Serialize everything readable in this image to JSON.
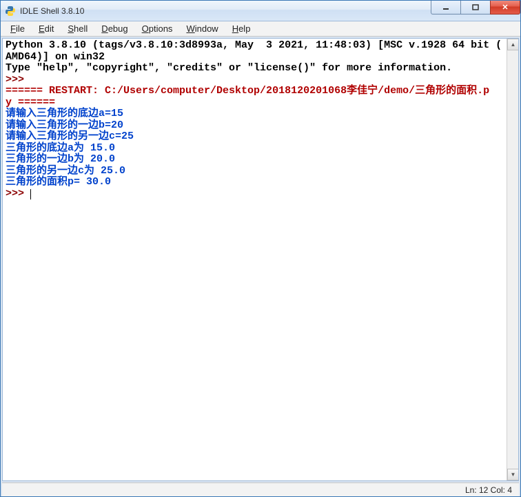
{
  "window": {
    "title": "IDLE Shell 3.8.10"
  },
  "menu": {
    "items": [
      "File",
      "Edit",
      "Shell",
      "Debug",
      "Options",
      "Window",
      "Help"
    ]
  },
  "console": {
    "banner_l1": "Python 3.8.10 (tags/v3.8.10:3d8993a, May  3 2021, 11:48:03) [MSC v.1928 64 bit (",
    "banner_l2": "AMD64)] on win32",
    "banner_l3": "Type \"help\", \"copyright\", \"credits\" or \"license()\" for more information.",
    "prompt": ">>> ",
    "restart_l1": "====== RESTART: C:/Users/computer/Desktop/2018120201068李佳宁/demo/三角形的面积.p",
    "restart_l2": "y ======",
    "lines": [
      "请输入三角形的底边a=15",
      "请输入三角形的一边b=20",
      "请输入三角形的另一边c=25",
      "三角形的底边a为 15.0",
      "三角形的一边b为 20.0",
      "三角形的另一边c为 25.0",
      "三角形的面积p= 30.0"
    ]
  },
  "status": {
    "text": "Ln: 12   Col: 4"
  }
}
